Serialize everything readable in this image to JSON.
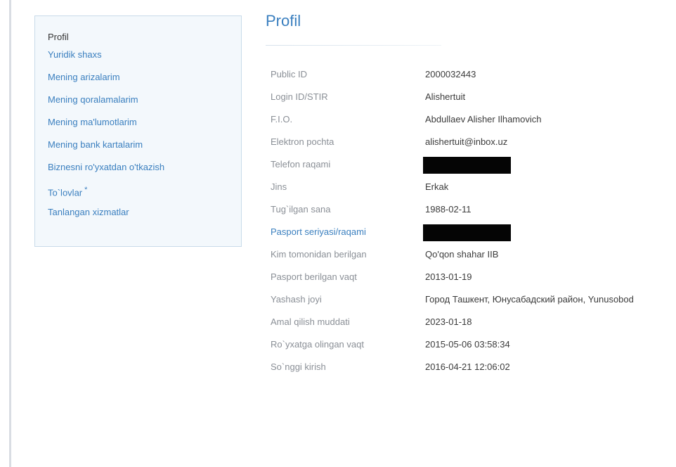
{
  "sidebar": {
    "title": "Profil",
    "items": [
      {
        "label": "Yuridik shaxs"
      },
      {
        "label": "Mening arizalarim"
      },
      {
        "label": "Mening qoralamalarim"
      },
      {
        "label": "Mening ma'lumotlarim"
      },
      {
        "label": "Mening bank kartalarim"
      },
      {
        "label": "Biznesni ro'yxatdan o'tkazish"
      },
      {
        "label": "To`lovlar",
        "badge": "*"
      },
      {
        "label": "Tanlangan xizmatlar"
      }
    ]
  },
  "main": {
    "title": "Profil",
    "rows": [
      {
        "label": "Public ID",
        "value": "2000032443"
      },
      {
        "label": "Login ID/STIR",
        "value": "Alishertuit"
      },
      {
        "label": "F.I.O.",
        "value": "Abdullaev Alisher Ilhamovich"
      },
      {
        "label": "Elektron pochta",
        "value": "alishertuit@inbox.uz"
      },
      {
        "label": "Telefon raqami",
        "value": ""
      },
      {
        "label": "Jins",
        "value": "Erkak"
      },
      {
        "label": "Tug`ilgan sana",
        "value": "1988-02-11"
      },
      {
        "label": "Pasport seriyasi/raqami",
        "value": ""
      },
      {
        "label": "Kim tomonidan berilgan",
        "value": "Qo'qon shahar IIB"
      },
      {
        "label": "Pasport berilgan vaqt",
        "value": "2013-01-19"
      },
      {
        "label": "Yashash joyi",
        "value": "Город Ташкент, Юнусабадский район, Yunusobod"
      },
      {
        "label": "Amal qilish muddati",
        "value": "2023-01-18"
      },
      {
        "label": "Ro`yxatga olingan vaqt",
        "value": "2015-05-06 03:58:34"
      },
      {
        "label": "So`nggi kirish",
        "value": "2016-04-21 12:06:02"
      }
    ]
  }
}
